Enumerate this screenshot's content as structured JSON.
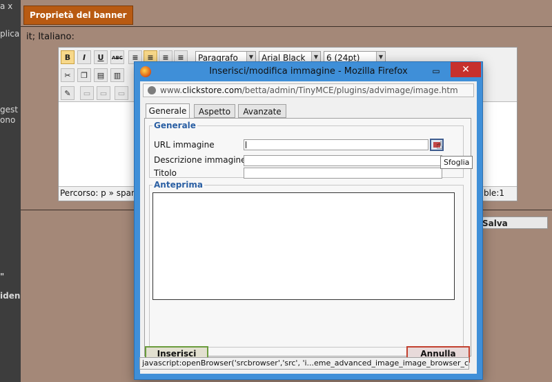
{
  "background": {
    "left_strip_texts": [
      "a x",
      "plica",
      "gest",
      "ono",
      "\"",
      "iden"
    ],
    "banner_tab": "Proprietà del banner",
    "lang_label": "it; Italiano:",
    "salva_label": "Salva",
    "editor": {
      "buttons_row1": [
        "B",
        "I",
        "U",
        "ABC"
      ],
      "format_select": "Paragrafo",
      "font_select": "Arial Black",
      "size_select": "6 (24pt)",
      "path_text": "Percorso: p » span",
      "status_right": "ble:1"
    }
  },
  "popup": {
    "title": "Inserisci/modifica immagine - Mozilla Firefox",
    "restore_glyph": "▭",
    "close_glyph": "✕",
    "url": {
      "prefix": "www.",
      "domain": "clickstore.com",
      "path": "/betta/admin/TinyMCE/plugins/advimage/image.htm"
    },
    "tabs": [
      "Generale",
      "Aspetto",
      "Avanzate"
    ],
    "general": {
      "legend": "Generale",
      "url_label": "URL immagine",
      "url_value": "",
      "desc_label": "Descrizione immagine",
      "desc_value": "",
      "title_label": "Titolo",
      "title_value": "",
      "browse_tooltip": "Sfoglia"
    },
    "preview": {
      "legend": "Anteprima"
    },
    "insert_label": "Inserisci",
    "cancel_label": "Annulla",
    "status_bar": "javascript:openBrowser('srcbrowser','src', 'i...eme_advanced_image_image_browser_callback');"
  }
}
